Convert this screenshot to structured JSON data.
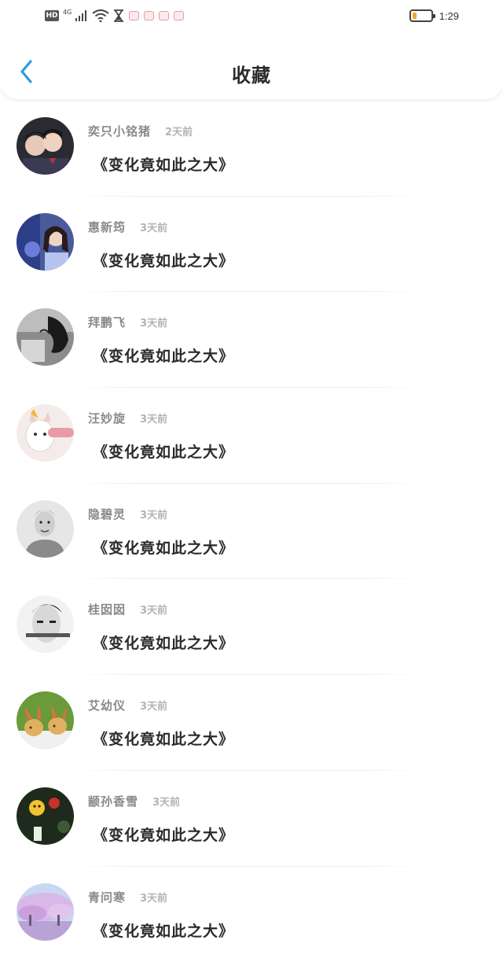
{
  "status_bar": {
    "hd": "HD",
    "network": "4G",
    "time": "1:29"
  },
  "header": {
    "title": "收藏"
  },
  "items": [
    {
      "user": "奕只小铭猪",
      "time": "2天前",
      "title": "《变化竟如此之大》"
    },
    {
      "user": "惠新筠",
      "time": "3天前",
      "title": "《变化竟如此之大》"
    },
    {
      "user": "拜鹏飞",
      "time": "3天前",
      "title": "《变化竟如此之大》"
    },
    {
      "user": "汪妙旋",
      "time": "3天前",
      "title": "《变化竟如此之大》"
    },
    {
      "user": "隐碧灵",
      "time": "3天前",
      "title": "《变化竟如此之大》"
    },
    {
      "user": "桂囡囡",
      "time": "3天前",
      "title": "《变化竟如此之大》"
    },
    {
      "user": "艾幼仪",
      "time": "3天前",
      "title": "《变化竟如此之大》"
    },
    {
      "user": "颛孙香雪",
      "time": "3天前",
      "title": "《变化竟如此之大》"
    },
    {
      "user": "青问寒",
      "time": "3天前",
      "title": "《变化竟如此之大》"
    }
  ],
  "colors": {
    "accent": "#2a9de0",
    "text": "#2a2a2a",
    "muted": "#8a8a8a"
  }
}
